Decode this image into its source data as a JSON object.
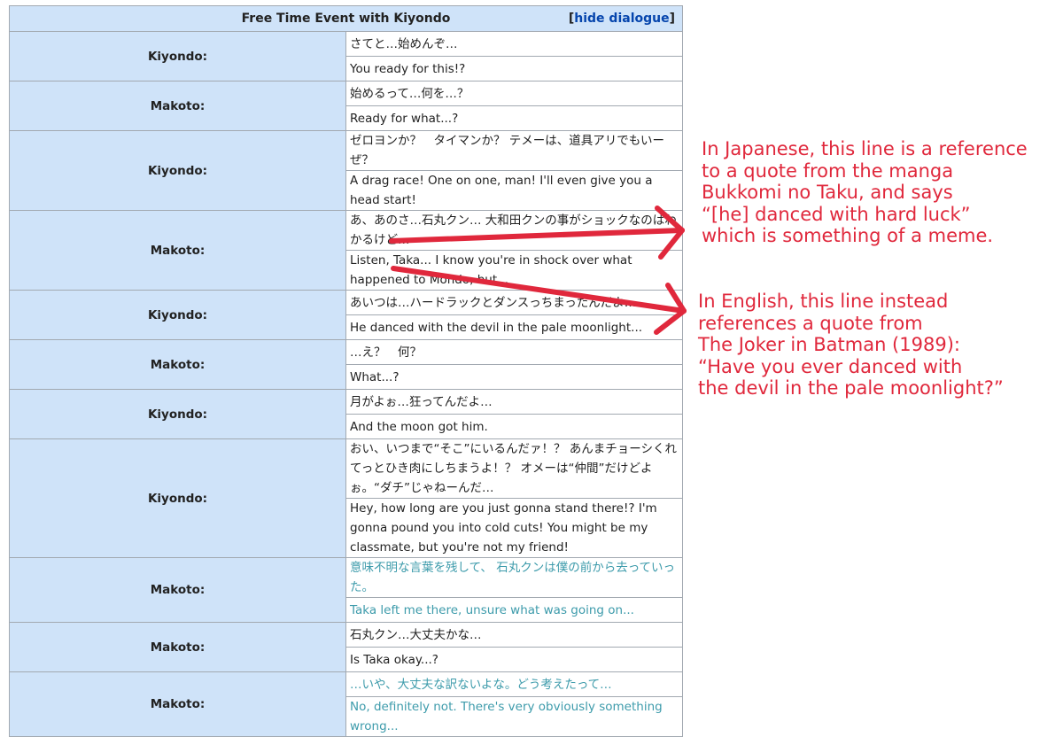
{
  "table": {
    "title": "Free Time Event with Kiyondo",
    "toggle": {
      "open_bracket": "[",
      "label": "hide dialogue",
      "close_bracket": "]"
    },
    "rows": [
      {
        "speaker": "Kiyondo:",
        "jp": "さてと…始めんぞ…",
        "en": "You ready for this!?"
      },
      {
        "speaker": "Makoto:",
        "jp": "始めるって…何を…？",
        "en": "Ready for what...?"
      },
      {
        "speaker": "Kiyondo:",
        "jp": "ゼロヨンか？　タイマンか？ テメーは、道具アリでもいーぜ？",
        "en": "A drag race! One on one, man! I'll even give you a head start!"
      },
      {
        "speaker": "Makoto:",
        "jp": "あ、あのさ…石丸クン… 大和田クンの事がショックなのはわかるけど…",
        "en": "Listen, Taka... I know you're in shock over what happened to Mondo, but..."
      },
      {
        "speaker": "Kiyondo:",
        "jp": "あいつは…ハードラックとダンスっちまったんだよ…",
        "en": "He danced with the devil in the pale moonlight..."
      },
      {
        "speaker": "Makoto:",
        "jp": "…え？　何？",
        "en": "What...?"
      },
      {
        "speaker": "Kiyondo:",
        "jp": "月がよぉ…狂ってんだよ…",
        "en": "And the moon got him."
      },
      {
        "speaker": "Kiyondo:",
        "jp": "おい、いつまで“そこ”にいるんだァ！？ あんまチョーシくれてっとひき肉にしちまうよ！？ オメーは“仲間”だけどよぉ。“ダチ”じゃねーんだ…",
        "en": "Hey, how long are you just gonna stand there!? I'm gonna pound you into cold cuts! You might be my classmate, but you're not my friend!"
      },
      {
        "speaker": "Makoto:",
        "jp": "意味不明な言葉を残して、 石丸クンは僕の前から去っていった。",
        "en": "Taka left me there, unsure what was going on..."
      },
      {
        "speaker": "Makoto:",
        "jp": "石丸クン…大丈夫かな…",
        "en": "Is Taka okay...?"
      },
      {
        "speaker": "Makoto:",
        "jp": "…いや、大丈夫な訳ないよな。どう考えたって…",
        "en": "No, definitely not. There's very obviously something wrong..."
      }
    ]
  },
  "annotations": {
    "japanese_note": "In Japanese, this line is a reference\nto a quote from the manga\nBukkomi no Taku, and says\n“[he] danced with hard luck”\nwhich is something of a meme.",
    "english_note": "In English, this line instead\nreferences a quote from\nThe Joker in Batman (1989):\n“Have you ever danced with\nthe devil in the pale moonlight?”",
    "color": "#e0283c"
  },
  "colors": {
    "header_bg": "#cfe3f9",
    "speaker_bg": "#cfe3f9",
    "border": "#a2a9b1",
    "link": "#0645ad",
    "narration": "#3d9bab"
  }
}
